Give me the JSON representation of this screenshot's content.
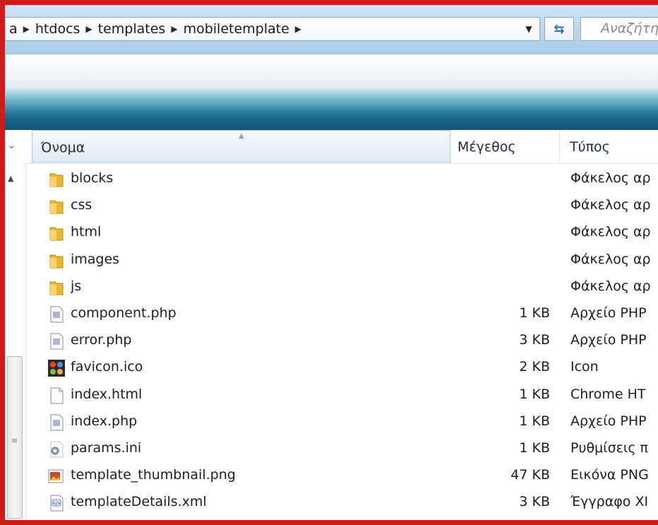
{
  "address": {
    "segments": [
      "a",
      "htdocs",
      "templates",
      "mobiletemplate"
    ],
    "search_placeholder": "Αναζήτη"
  },
  "columns": {
    "name": "Όνομα",
    "size": "Μέγεθος",
    "type": "Τύπος"
  },
  "files": [
    {
      "name": "blocks",
      "size": "",
      "type": "Φάκελος αρ",
      "icon": "folder-icon"
    },
    {
      "name": "css",
      "size": "",
      "type": "Φάκελος αρ",
      "icon": "folder-icon"
    },
    {
      "name": "html",
      "size": "",
      "type": "Φάκελος αρ",
      "icon": "folder-icon"
    },
    {
      "name": "images",
      "size": "",
      "type": "Φάκελος αρ",
      "icon": "folder-icon"
    },
    {
      "name": "js",
      "size": "",
      "type": "Φάκελος αρ",
      "icon": "folder-icon"
    },
    {
      "name": "component.php",
      "size": "1 KB",
      "type": "Αρχείο PHP",
      "icon": "php-file-icon"
    },
    {
      "name": "error.php",
      "size": "3 KB",
      "type": "Αρχείο PHP",
      "icon": "php-file-icon"
    },
    {
      "name": "favicon.ico",
      "size": "2 KB",
      "type": "Icon",
      "icon": "joomla-icon"
    },
    {
      "name": "index.html",
      "size": "1 KB",
      "type": "Chrome HT",
      "icon": "html-file-icon"
    },
    {
      "name": "index.php",
      "size": "1 KB",
      "type": "Αρχείο PHP",
      "icon": "php-file-icon"
    },
    {
      "name": "params.ini",
      "size": "1 KB",
      "type": "Ρυθμίσεις π",
      "icon": "settings-file-icon"
    },
    {
      "name": "template_thumbnail.png",
      "size": "47 KB",
      "type": "Εικόνα PNG",
      "icon": "image-file-icon"
    },
    {
      "name": "templateDetails.xml",
      "size": "3 KB",
      "type": "Έγγραφο XI",
      "icon": "xml-file-icon"
    }
  ],
  "colors": {
    "frame": "#d11a1a",
    "folder": "#e8b832",
    "header_highlight": "#dcebf8"
  }
}
